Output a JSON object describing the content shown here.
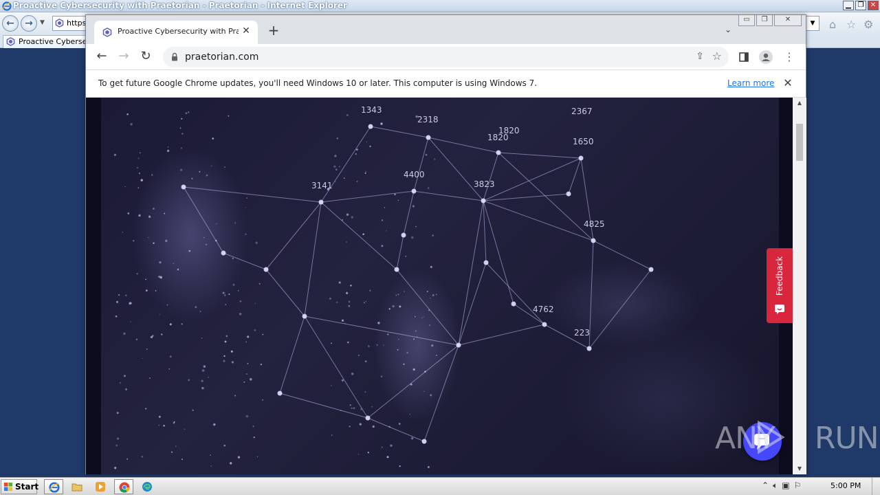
{
  "ie": {
    "title": "Proactive Cybersecurity with Praetorian - Praetorian - Internet Explorer",
    "address_partial": "https",
    "tab_label": "Proactive Cybersecurity with Praetorian"
  },
  "chrome": {
    "tab_title": "Proactive Cybersecurity with Praetorian",
    "url": "praetorian.com",
    "infobar_text": "To get future Google Chrome updates, you'll need Windows 10 or later. This computer is using Windows 7.",
    "infobar_link": "Learn more"
  },
  "page": {
    "feedback_label": "Feedback",
    "hero_numbers": [
      "1343",
      "2318",
      "1820",
      "1650",
      "3141",
      "4400",
      "3823",
      "4825",
      "4762",
      "223",
      "1820",
      "2367"
    ]
  },
  "taskbar": {
    "start_label": "Start",
    "clock": "5:00 PM"
  },
  "watermark": {
    "left": "ANY",
    "right": "RUN"
  },
  "colors": {
    "feedback_bg": "#d8263d",
    "chat_bg": "#4548ff",
    "link": "#1a73e8"
  }
}
